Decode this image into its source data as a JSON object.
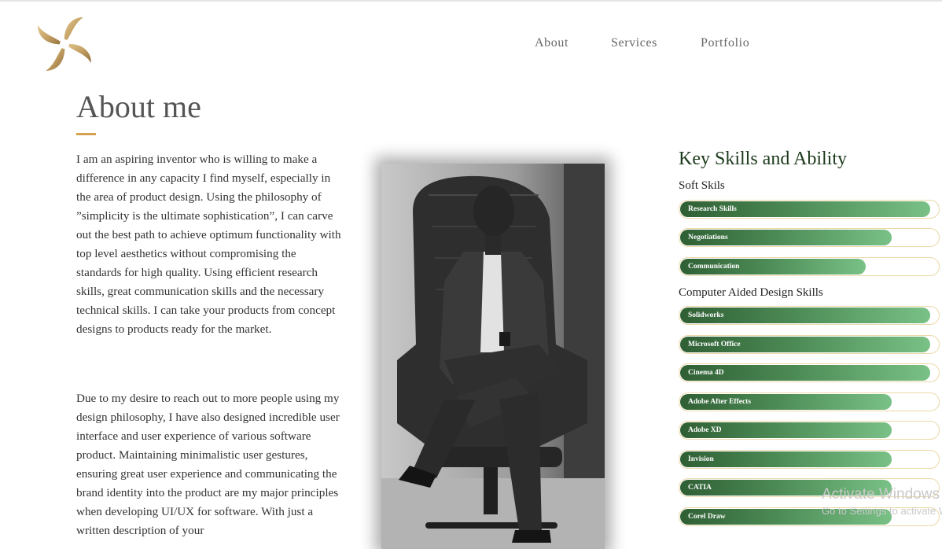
{
  "nav": {
    "items": [
      "About",
      "Services",
      "Portfolio"
    ]
  },
  "about": {
    "title": "About me",
    "paragraphs": [
      "I am an aspiring inventor who is willing to make a difference in any capacity I find myself, especially in the area of product design. Using the philosophy of ”simplicity is the ultimate sophistication”, I can carve out the best path to achieve optimum functionality with top level aesthetics without compromising the standards for high quality. Using efficient research skills, great communication skills and the necessary technical skills. I can take your products from concept designs to products ready for the market.",
      "Due to my desire to reach out to more people using my design philosophy, I have also designed incredible user interface and user experience of various software product. Maintaining minimalistic user gestures, ensuring great user experience and communicating the brand identity into the product are my major principles when developing UI/UX for software. With just a written description of your"
    ]
  },
  "skills": {
    "title": "Key Skills and Ability",
    "groups": [
      {
        "title": "Soft Skils",
        "items": [
          {
            "label": "Research Skills",
            "level": 97
          },
          {
            "label": "Negotiations",
            "level": 82
          },
          {
            "label": "Communication",
            "level": 72
          }
        ]
      },
      {
        "title": "Computer Aided Design Skills",
        "items": [
          {
            "label": "Solidworks",
            "level": 97
          },
          {
            "label": "Microsoft Office",
            "level": 97
          },
          {
            "label": "Cinema 4D",
            "level": 97
          },
          {
            "label": "Adobe After Effects",
            "level": 82
          },
          {
            "label": "Adobe XD",
            "level": 82
          },
          {
            "label": "Invision",
            "level": 82
          },
          {
            "label": "CATIA",
            "level": 82
          },
          {
            "label": "Corel Draw",
            "level": 82
          }
        ]
      }
    ]
  },
  "watermark": {
    "line1": "Activate Windows",
    "line2": "Go to Settings to activate Windows."
  },
  "colors": {
    "accent_gold": "#d4a24c",
    "bar_dark": "#2f5f34",
    "bar_light": "#79c186",
    "bar_border": "#ecd9a8"
  }
}
